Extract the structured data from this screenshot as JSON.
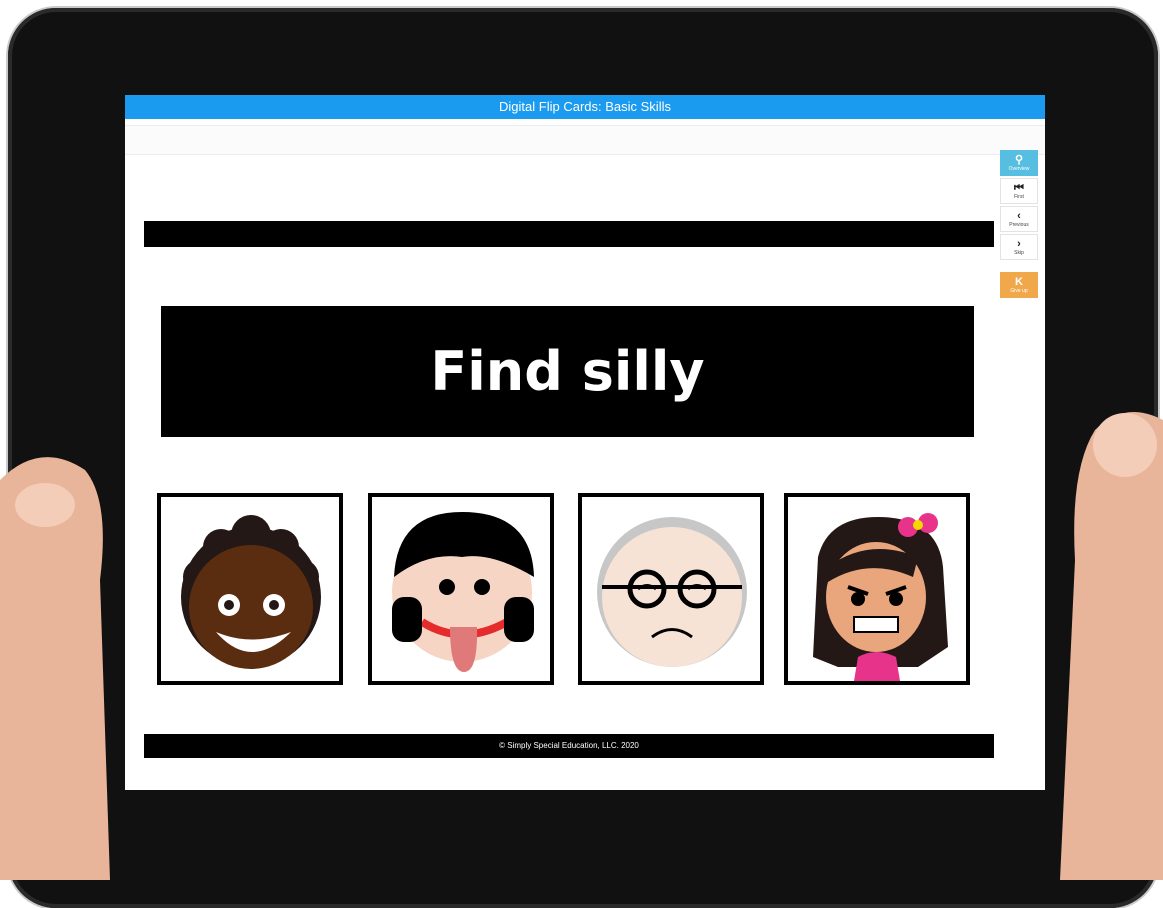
{
  "app": {
    "title": "Digital Flip Cards: Basic Skills"
  },
  "prompt": {
    "text": "Find silly"
  },
  "footer": {
    "text": "©  Simply Special Education, LLC. 2020"
  },
  "controls": [
    {
      "label": "Overview",
      "icon": "magnifier-icon",
      "glyph": "⚲"
    },
    {
      "label": "First",
      "icon": "first-icon",
      "glyph": "⏮"
    },
    {
      "label": "Previous",
      "icon": "chevron-left-icon",
      "glyph": "‹"
    },
    {
      "label": "Skip",
      "icon": "chevron-right-icon",
      "glyph": "›"
    },
    {
      "label": "Give up",
      "icon": "give-up-icon",
      "glyph": "K"
    }
  ],
  "cards": [
    {
      "emotion": "happy"
    },
    {
      "emotion": "silly"
    },
    {
      "emotion": "sad"
    },
    {
      "emotion": "angry"
    }
  ],
  "colors": {
    "titlebar": "#1a9bf0",
    "overview_button": "#56bee0",
    "give_up_button": "#f0a84a",
    "prompt_bg": "#000000"
  }
}
